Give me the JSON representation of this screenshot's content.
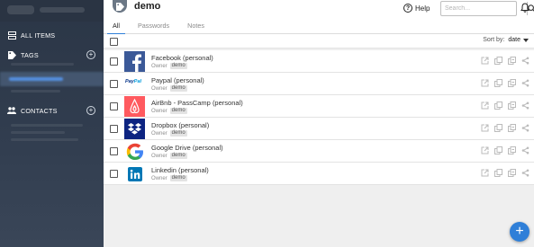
{
  "header": {
    "title": "demo",
    "help_label": "Help",
    "search_placeholder": "Search..."
  },
  "tabs": [
    {
      "label": "All",
      "active": true
    },
    {
      "label": "Passwords",
      "active": false
    },
    {
      "label": "Notes",
      "active": false
    }
  ],
  "sidebar": {
    "all_items": "ALL ITEMS",
    "tags": "TAGS",
    "contacts": "CONTACTS"
  },
  "list": {
    "sort_label": "Sort by:",
    "sort_value": "date",
    "items": [
      {
        "name": "Facebook (personal)",
        "owner_label": "Owner",
        "owner": "demo",
        "logo": "facebook-logo",
        "brand_color": "#3b5998"
      },
      {
        "name": "Paypal (personal)",
        "owner_label": "Owner",
        "owner": "demo",
        "logo": "paypal-logo",
        "brand_color": "#003087"
      },
      {
        "name": "AirBnb - PassCamp (personal)",
        "owner_label": "Owner",
        "owner": "demo",
        "logo": "airbnb-logo",
        "brand_color": "#ff5a5f"
      },
      {
        "name": "Dropbox (personal)",
        "owner_label": "Owner",
        "owner": "demo",
        "logo": "dropbox-logo",
        "brand_color": "#0d2481"
      },
      {
        "name": "Google Drive (personal)",
        "owner_label": "Owner",
        "owner": "demo",
        "logo": "google-logo",
        "brand_color": "#4285f4"
      },
      {
        "name": "Linkedin (personal)",
        "owner_label": "Owner",
        "owner": "demo",
        "logo": "linkedin-logo",
        "brand_color": "#0077b5"
      }
    ]
  },
  "fab": {
    "label": "+"
  },
  "colors": {
    "accent": "#2f7fd8",
    "sidebar_bg": "#2b3646"
  }
}
